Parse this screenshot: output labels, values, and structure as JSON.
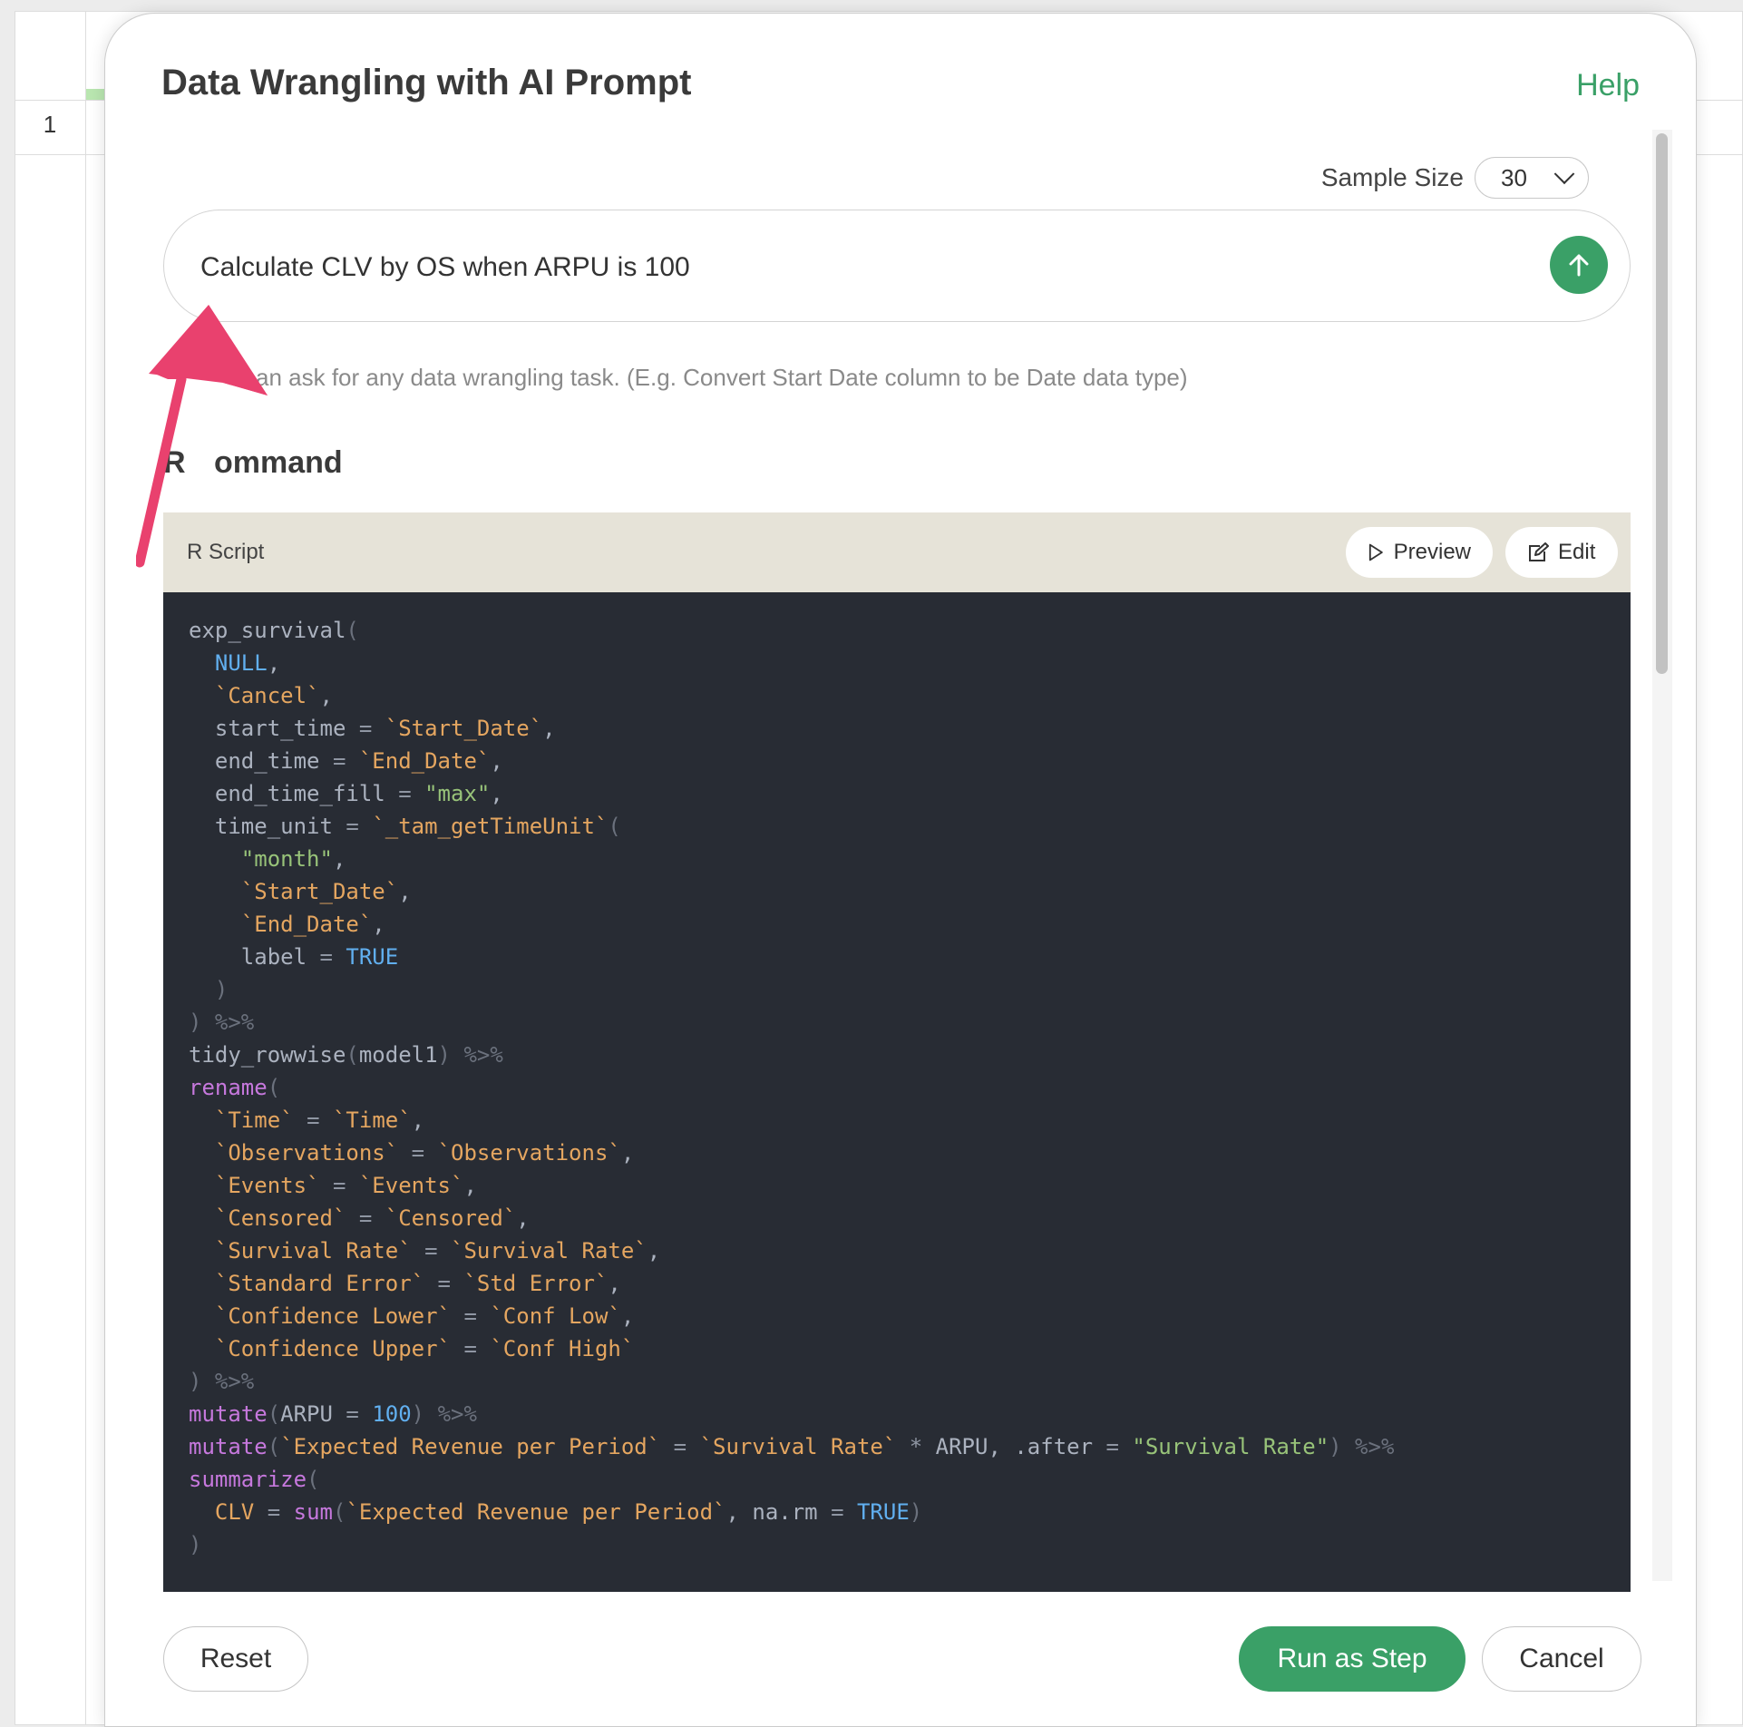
{
  "sheet": {
    "row_number": "1"
  },
  "dialog": {
    "title": "Data Wrangling with AI Prompt",
    "help_label": "Help",
    "sample_size_label": "Sample Size",
    "sample_size_value": "30",
    "prompt_text": "Calculate CLV by OS when ARPU is 100",
    "hint_text": "an ask for any data wrangling task. (E.g. Convert Start Date column to be Date data type)",
    "section_title_prefix": "R",
    "section_title_suffix": "ommand",
    "script_label": "R Script",
    "preview_label": "Preview",
    "edit_label": "Edit",
    "reset_label": "Reset",
    "run_label": "Run as Step",
    "cancel_label": "Cancel",
    "accent_color": "#3aa067",
    "annotation_arrow_color": "#e9416e"
  },
  "code_lines": [
    [
      [
        "fn0",
        "exp_survival"
      ],
      [
        "pu",
        "("
      ]
    ],
    [
      [
        "sp",
        "  "
      ],
      [
        "kw",
        "NULL"
      ],
      [
        "pl",
        ","
      ]
    ],
    [
      [
        "sp",
        "  "
      ],
      [
        "bt",
        "`Cancel`"
      ],
      [
        "pl",
        ","
      ]
    ],
    [
      [
        "sp",
        "  "
      ],
      [
        "pl",
        "start_time "
      ],
      [
        "op",
        "="
      ],
      [
        "pl",
        " "
      ],
      [
        "bt",
        "`Start_Date`"
      ],
      [
        "pl",
        ","
      ]
    ],
    [
      [
        "sp",
        "  "
      ],
      [
        "pl",
        "end_time "
      ],
      [
        "op",
        "="
      ],
      [
        "pl",
        " "
      ],
      [
        "bt",
        "`End_Date`"
      ],
      [
        "pl",
        ","
      ]
    ],
    [
      [
        "sp",
        "  "
      ],
      [
        "pl",
        "end_time_fill "
      ],
      [
        "op",
        "="
      ],
      [
        "pl",
        " "
      ],
      [
        "st",
        "\"max\""
      ],
      [
        "pl",
        ","
      ]
    ],
    [
      [
        "sp",
        "  "
      ],
      [
        "pl",
        "time_unit "
      ],
      [
        "op",
        "="
      ],
      [
        "pl",
        " "
      ],
      [
        "bt",
        "`_tam_getTimeUnit`"
      ],
      [
        "pu",
        "("
      ]
    ],
    [
      [
        "sp",
        "    "
      ],
      [
        "st",
        "\"month\""
      ],
      [
        "pl",
        ","
      ]
    ],
    [
      [
        "sp",
        "    "
      ],
      [
        "bt",
        "`Start_Date`"
      ],
      [
        "pl",
        ","
      ]
    ],
    [
      [
        "sp",
        "    "
      ],
      [
        "bt",
        "`End_Date`"
      ],
      [
        "pl",
        ","
      ]
    ],
    [
      [
        "sp",
        "    "
      ],
      [
        "pl",
        "label "
      ],
      [
        "op",
        "="
      ],
      [
        "pl",
        " "
      ],
      [
        "kw",
        "TRUE"
      ]
    ],
    [
      [
        "sp",
        "  "
      ],
      [
        "pu",
        ")"
      ]
    ],
    [
      [
        "pu",
        ") %>%"
      ]
    ],
    [
      [
        "pl",
        "tidy_rowwise"
      ],
      [
        "pu",
        "("
      ],
      [
        "pl",
        "model1"
      ],
      [
        "pu",
        ") %>%"
      ]
    ],
    [
      [
        "fn",
        "rename"
      ],
      [
        "pu",
        "("
      ]
    ],
    [
      [
        "sp",
        "  "
      ],
      [
        "bt",
        "`Time`"
      ],
      [
        "pl",
        " "
      ],
      [
        "op",
        "="
      ],
      [
        "pl",
        " "
      ],
      [
        "bt",
        "`Time`"
      ],
      [
        "pl",
        ","
      ]
    ],
    [
      [
        "sp",
        "  "
      ],
      [
        "bt",
        "`Observations`"
      ],
      [
        "pl",
        " "
      ],
      [
        "op",
        "="
      ],
      [
        "pl",
        " "
      ],
      [
        "bt",
        "`Observations`"
      ],
      [
        "pl",
        ","
      ]
    ],
    [
      [
        "sp",
        "  "
      ],
      [
        "bt",
        "`Events`"
      ],
      [
        "pl",
        " "
      ],
      [
        "op",
        "="
      ],
      [
        "pl",
        " "
      ],
      [
        "bt",
        "`Events`"
      ],
      [
        "pl",
        ","
      ]
    ],
    [
      [
        "sp",
        "  "
      ],
      [
        "bt",
        "`Censored`"
      ],
      [
        "pl",
        " "
      ],
      [
        "op",
        "="
      ],
      [
        "pl",
        " "
      ],
      [
        "bt",
        "`Censored`"
      ],
      [
        "pl",
        ","
      ]
    ],
    [
      [
        "sp",
        "  "
      ],
      [
        "bt",
        "`Survival Rate`"
      ],
      [
        "pl",
        " "
      ],
      [
        "op",
        "="
      ],
      [
        "pl",
        " "
      ],
      [
        "bt",
        "`Survival Rate`"
      ],
      [
        "pl",
        ","
      ]
    ],
    [
      [
        "sp",
        "  "
      ],
      [
        "bt",
        "`Standard Error`"
      ],
      [
        "pl",
        " "
      ],
      [
        "op",
        "="
      ],
      [
        "pl",
        " "
      ],
      [
        "bt",
        "`Std Error`"
      ],
      [
        "pl",
        ","
      ]
    ],
    [
      [
        "sp",
        "  "
      ],
      [
        "bt",
        "`Confidence Lower`"
      ],
      [
        "pl",
        " "
      ],
      [
        "op",
        "="
      ],
      [
        "pl",
        " "
      ],
      [
        "bt",
        "`Conf Low`"
      ],
      [
        "pl",
        ","
      ]
    ],
    [
      [
        "sp",
        "  "
      ],
      [
        "bt",
        "`Confidence Upper`"
      ],
      [
        "pl",
        " "
      ],
      [
        "op",
        "="
      ],
      [
        "pl",
        " "
      ],
      [
        "bt",
        "`Conf High`"
      ]
    ],
    [
      [
        "pu",
        ") %>%"
      ]
    ],
    [
      [
        "fn",
        "mutate"
      ],
      [
        "pu",
        "("
      ],
      [
        "pl",
        "ARPU "
      ],
      [
        "op",
        "="
      ],
      [
        "pl",
        " "
      ],
      [
        "nm",
        "100"
      ],
      [
        "pu",
        ") %>%"
      ]
    ],
    [
      [
        "fn",
        "mutate"
      ],
      [
        "pu",
        "("
      ],
      [
        "bt",
        "`Expected Revenue per Period`"
      ],
      [
        "pl",
        " "
      ],
      [
        "op",
        "="
      ],
      [
        "pl",
        " "
      ],
      [
        "bt",
        "`Survival Rate`"
      ],
      [
        "pl",
        " "
      ],
      [
        "op",
        "*"
      ],
      [
        "pl",
        " ARPU, .after "
      ],
      [
        "op",
        "="
      ],
      [
        "pl",
        " "
      ],
      [
        "st",
        "\"Survival Rate\""
      ],
      [
        "pu",
        ") %>%"
      ]
    ],
    [
      [
        "fn",
        "summarize"
      ],
      [
        "pu",
        "("
      ]
    ],
    [
      [
        "sp",
        "  "
      ],
      [
        "bt",
        "CLV"
      ],
      [
        "pl",
        " "
      ],
      [
        "op",
        "="
      ],
      [
        "pl",
        " "
      ],
      [
        "fn",
        "sum"
      ],
      [
        "pu",
        "("
      ],
      [
        "bt",
        "`Expected Revenue per Period`"
      ],
      [
        "pl",
        ", na.rm "
      ],
      [
        "op",
        "="
      ],
      [
        "pl",
        " "
      ],
      [
        "kw",
        "TRUE"
      ],
      [
        "pu",
        ")"
      ]
    ],
    [
      [
        "pu",
        ")"
      ]
    ]
  ]
}
